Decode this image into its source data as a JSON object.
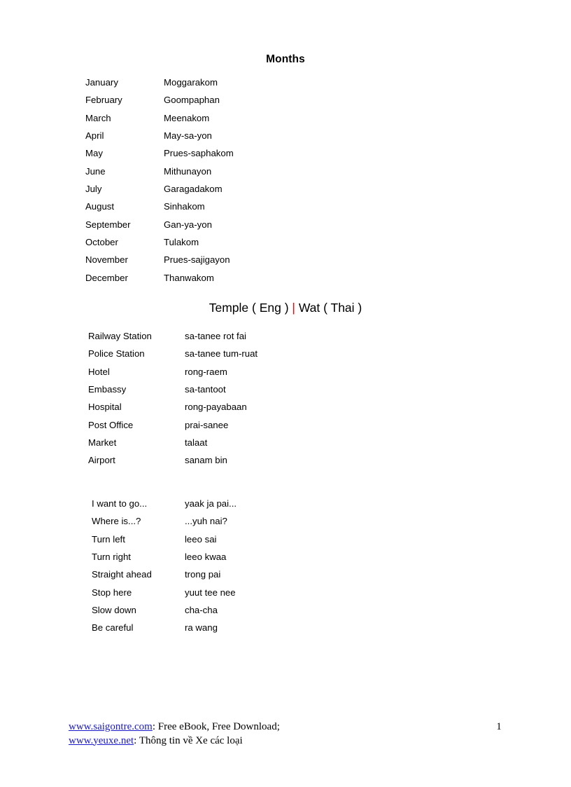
{
  "document": {
    "page_number": "1"
  },
  "sections": {
    "months": {
      "heading": "Months",
      "rows": [
        {
          "term": "January",
          "gloss": "Moggarakom"
        },
        {
          "term": "February",
          "gloss": "Goompaphan"
        },
        {
          "term": "March",
          "gloss": "Meenakom"
        },
        {
          "term": "April",
          "gloss": "May-sa-yon"
        },
        {
          "term": "May",
          "gloss": "Prues-saphakom"
        },
        {
          "term": "June",
          "gloss": "Mithunayon"
        },
        {
          "term": "July",
          "gloss": "Garagadakom"
        },
        {
          "term": "August",
          "gloss": "Sinhakom"
        },
        {
          "term": "September",
          "gloss": "Gan-ya-yon"
        },
        {
          "term": "October",
          "gloss": "Tulakom"
        },
        {
          "term": "November",
          "gloss": "Prues-sajigayon"
        },
        {
          "term": "December",
          "gloss": "Thanwakom"
        }
      ]
    },
    "temple": {
      "heading_left": "Temple ( Eng ) ",
      "heading_separator": "|",
      "heading_right": " Wat ( Thai )",
      "separator_color": "#ff0000"
    },
    "places": {
      "rows": [
        {
          "term": "Railway Station",
          "gloss": "sa-tanee rot fai"
        },
        {
          "term": "Police Station",
          "gloss": "sa-tanee tum-ruat"
        },
        {
          "term": "Hotel",
          "gloss": "rong-raem"
        },
        {
          "term": "Embassy",
          "gloss": "sa-tantoot"
        },
        {
          "term": "Hospital",
          "gloss": "rong-payabaan"
        },
        {
          "term": "Post Office",
          "gloss": "prai-sanee"
        },
        {
          "term": "Market",
          "gloss": "talaat"
        },
        {
          "term": "Airport",
          "gloss": "sanam bin"
        }
      ]
    },
    "directions": {
      "rows": [
        {
          "term": "I want to go...",
          "gloss": "yaak ja pai..."
        },
        {
          "term": "Where is...?",
          "gloss": "...yuh nai?"
        },
        {
          "term": "Turn left",
          "gloss": "leeo sai"
        },
        {
          "term": "Turn right",
          "gloss": "leeo kwaa"
        },
        {
          "term": "Straight ahead",
          "gloss": "trong pai"
        },
        {
          "term": "Stop here",
          "gloss": "yuut tee nee"
        },
        {
          "term": "Slow down",
          "gloss": "cha-cha"
        },
        {
          "term": "Be careful",
          "gloss": "ra wang"
        }
      ]
    }
  },
  "footer": {
    "line1": {
      "link_text": "www.saigontre.com",
      "rest_text": ": Free eBook, Free Download;"
    },
    "line2": {
      "link_text": "www.yeuxe.net",
      "rest_text": ": Thông tin về Xe các loại"
    },
    "link_color": "#1a1aca"
  }
}
